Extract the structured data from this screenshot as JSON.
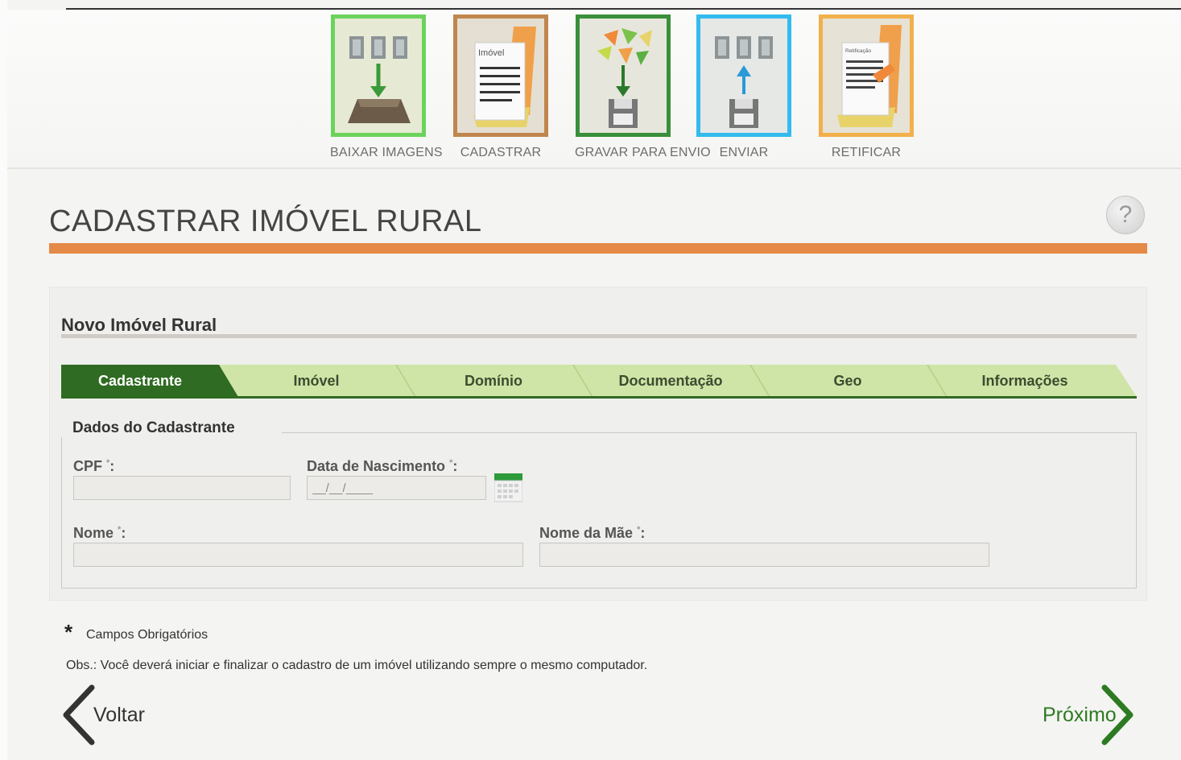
{
  "toolbar": {
    "items": [
      {
        "label": "BAIXAR IMAGENS",
        "color": "#66cc55"
      },
      {
        "label": "CADASTRAR",
        "color": "#c0864e",
        "icon_doc_text": "Imóvel"
      },
      {
        "label": "GRAVAR PARA ENVIO",
        "color": "#3a8f3a"
      },
      {
        "label": "ENVIAR",
        "color": "#33bbee"
      },
      {
        "label": "RETIFICAR",
        "color": "#f2b04a",
        "icon_doc_text": "Retificação"
      }
    ]
  },
  "page": {
    "title": "CADASTRAR IMÓVEL RURAL",
    "help_icon": "?",
    "accent_color": "#e48a46"
  },
  "panel": {
    "title": "Novo Imóvel Rural",
    "tabs": [
      {
        "label": "Cadastrante",
        "active": true
      },
      {
        "label": "Imóvel",
        "active": false
      },
      {
        "label": "Domínio",
        "active": false
      },
      {
        "label": "Documentação",
        "active": false
      },
      {
        "label": "Geo",
        "active": false
      },
      {
        "label": "Informações",
        "active": false
      }
    ],
    "active_tab_color": "#2f6b22",
    "inactive_tab_color": "#cfe5a7"
  },
  "form": {
    "legend": "Dados do Cadastrante",
    "cpf": {
      "label": "CPF",
      "required_mark": "*",
      "suffix": ":",
      "value": ""
    },
    "birth": {
      "label": "Data de Nascimento",
      "required_mark": "*",
      "suffix": ":",
      "value": "__/__/____"
    },
    "name": {
      "label": "Nome",
      "required_mark": "*",
      "suffix": ":",
      "value": ""
    },
    "mother": {
      "label": "Nome da Mãe",
      "required_mark": "*",
      "suffix": ":",
      "value": ""
    }
  },
  "notes": {
    "required_star": "*",
    "required_text": "Campos Obrigatórios",
    "obs": "Obs.: Você deverá iniciar e finalizar o cadastro de um imóvel utilizando sempre o mesmo computador."
  },
  "nav": {
    "back_label": "Voltar",
    "next_label": "Próximo"
  }
}
